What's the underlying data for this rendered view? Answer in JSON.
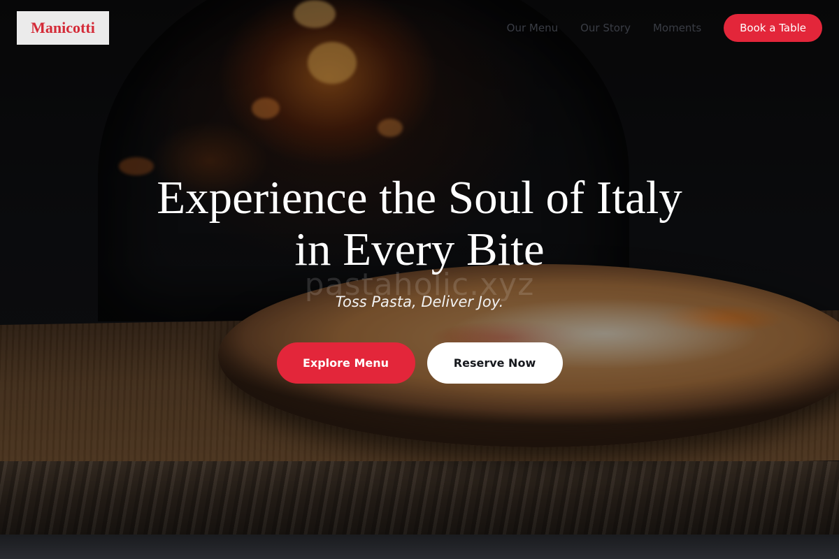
{
  "brand": {
    "logo_text": "Manicotti",
    "accent_color": "#e3263a"
  },
  "nav": {
    "links": [
      "Our Menu",
      "Our Story",
      "Moments"
    ],
    "cta_label": "Book a Table"
  },
  "hero": {
    "headline_line1": "Experience the Soul of Italy",
    "headline_line2": "in Every Bite",
    "watermark": "pastaholic.xyz",
    "tagline": "Toss Pasta, Deliver Joy.",
    "primary_cta": "Explore Menu",
    "secondary_cta": "Reserve Now"
  }
}
